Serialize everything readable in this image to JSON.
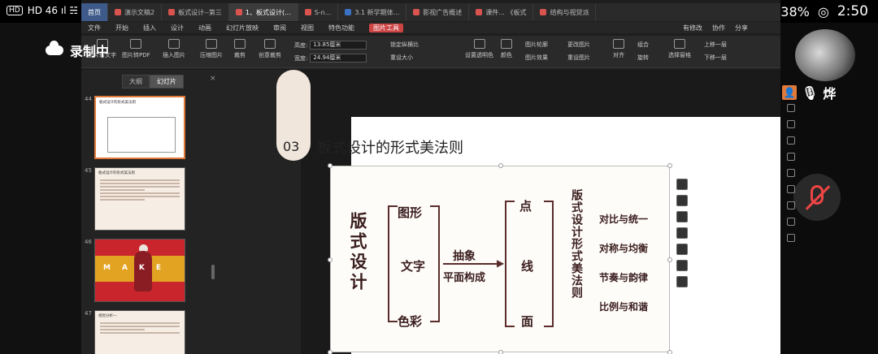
{
  "status_bar": {
    "left": "HD 46 ıl ☵ 46",
    "battery": "38%",
    "time": "2:50"
  },
  "recording": {
    "label": "录制中"
  },
  "tabs": [
    {
      "label": "首页"
    },
    {
      "label": "演示文稿2"
    },
    {
      "label": "板式设计--第三"
    },
    {
      "label": "1、板式设计(..."
    },
    {
      "label": "S-n..."
    },
    {
      "label": "3.1 新学期体..."
    },
    {
      "label": "影视广告概述"
    },
    {
      "label": "课件... 《板式"
    },
    {
      "label": "结构与视觉派"
    }
  ],
  "menu": {
    "items": [
      "文件",
      "开始",
      "插入",
      "设计",
      "动画",
      "幻灯片放映",
      "审阅",
      "视图",
      "特色功能",
      "图片工具"
    ],
    "selected": "图片工具",
    "right": [
      "有修改",
      "协作",
      "分享"
    ]
  },
  "ribbon": {
    "btn_pic_to_text": "图片转文字",
    "btn_pic_to_pdf": "图片转PDF",
    "btn_insert_pic": "插入图片",
    "btn_compress": "压缩图片",
    "btn_crop": "裁剪",
    "btn_creative_crop": "创意裁剪",
    "height_label": "高度:",
    "height_value": "13.85厘米",
    "width_label": "宽度:",
    "width_value": "24.94厘米",
    "lock_ratio": "锁定纵横比",
    "reset_size": "重设大小",
    "transparent": "设置透明色",
    "color": "颜色",
    "pic_outline": "图片轮廓",
    "pic_effect": "图片效果",
    "change_pic": "更改图片",
    "reset_pic": "重设图片",
    "align": "对齐",
    "group": "组合",
    "rotate": "旋转",
    "select_pane": "选择窗格",
    "bring_forward": "上移一层",
    "send_backward": "下移一层"
  },
  "panel": {
    "tab_outline": "大纲",
    "tab_slides": "幻灯片",
    "close": "×",
    "slides": [
      {
        "num": "44",
        "title": "板式设计的形式美法则"
      },
      {
        "num": "45",
        "title": "板式设计的形式美法则"
      },
      {
        "num": "46",
        "title": "MAKE"
      },
      {
        "num": "47",
        "title": "视觉分析一"
      }
    ]
  },
  "slide": {
    "number": "03",
    "title": "板式设计的形式美法则",
    "diagram": {
      "root": "版式设计",
      "elements": [
        "图形",
        "文字",
        "色彩"
      ],
      "process_top": "抽象",
      "process_bottom": "平面构成",
      "basics": [
        "点",
        "线",
        "面"
      ],
      "rule_heading": "版式设计形式美法则",
      "rules": [
        "对比与统一",
        "对称与均衡",
        "节奏与韵律",
        "比例与和谐"
      ]
    }
  },
  "participant": {
    "name": "烨"
  }
}
